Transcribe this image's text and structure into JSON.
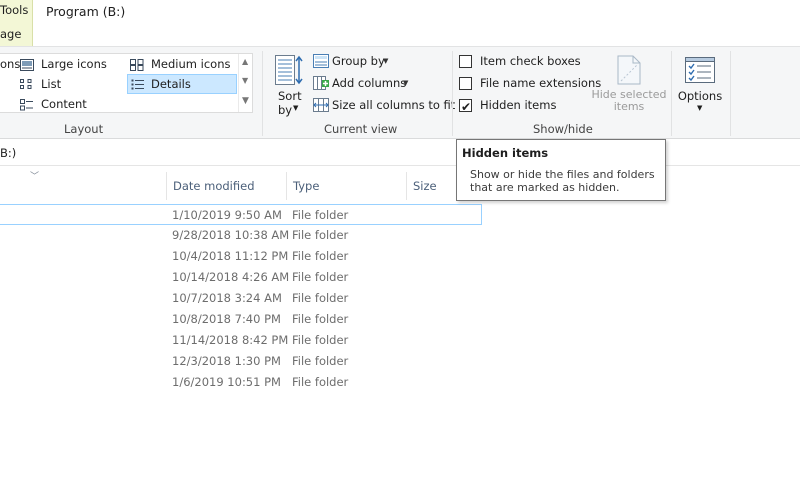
{
  "titlebar": {
    "tools_tab_line1": "Tools",
    "tools_tab_line2": "age",
    "window_title": "Program (B:)"
  },
  "ribbon": {
    "layout": {
      "group_label": "Layout",
      "items": [
        {
          "label": "ons",
          "icon": "extra-large-icons-icon"
        },
        {
          "label": "Large icons",
          "icon": "large-icons-icon"
        },
        {
          "label": "Medium icons",
          "icon": "medium-icons-icon"
        },
        {
          "label": "List",
          "icon": "list-view-icon"
        },
        {
          "label": "Details",
          "icon": "details-view-icon",
          "selected": true
        },
        {
          "label": "Content",
          "icon": "content-view-icon"
        }
      ]
    },
    "current_view": {
      "group_label": "Current view",
      "sort_by_line1": "Sort",
      "sort_by_line2": "by",
      "group_by": "Group by",
      "add_columns": "Add columns",
      "size_all_columns": "Size all columns to fit"
    },
    "show_hide": {
      "group_label": "Show/hide",
      "item_check_boxes": {
        "label": "Item check boxes",
        "checked": false
      },
      "file_name_extensions": {
        "label": "File name extensions",
        "checked": false
      },
      "hidden_items": {
        "label": "Hidden items",
        "checked": true
      },
      "hide_selected_line1": "Hide selected",
      "hide_selected_line2": "items"
    },
    "options": {
      "label": "Options"
    }
  },
  "address": {
    "text": "B:)"
  },
  "columns": {
    "date_modified": "Date modified",
    "type": "Type",
    "size": "Size"
  },
  "rows": [
    {
      "date": "1/10/2019 9:50 AM",
      "type": "File folder"
    },
    {
      "date": "9/28/2018 10:38 AM",
      "type": "File folder"
    },
    {
      "date": "10/4/2018 11:12 PM",
      "type": "File folder"
    },
    {
      "date": "10/14/2018 4:26 AM",
      "type": "File folder"
    },
    {
      "date": "10/7/2018 3:24 AM",
      "type": "File folder"
    },
    {
      "date": "10/8/2018 7:40 PM",
      "type": "File folder"
    },
    {
      "date": "11/14/2018 8:42 PM",
      "type": "File folder"
    },
    {
      "date": "12/3/2018 1:30 PM",
      "type": "File folder"
    },
    {
      "date": "1/6/2019 10:51 PM",
      "type": "File folder"
    }
  ],
  "tooltip": {
    "title": "Hidden items",
    "body": "Show or hide the files and folders that are marked as hidden."
  },
  "colors": {
    "tools_tab_bg": "#f3f7d6",
    "selection_bg": "#cce8ff",
    "selection_border": "#99d1ff",
    "header_text": "#4c607a"
  }
}
